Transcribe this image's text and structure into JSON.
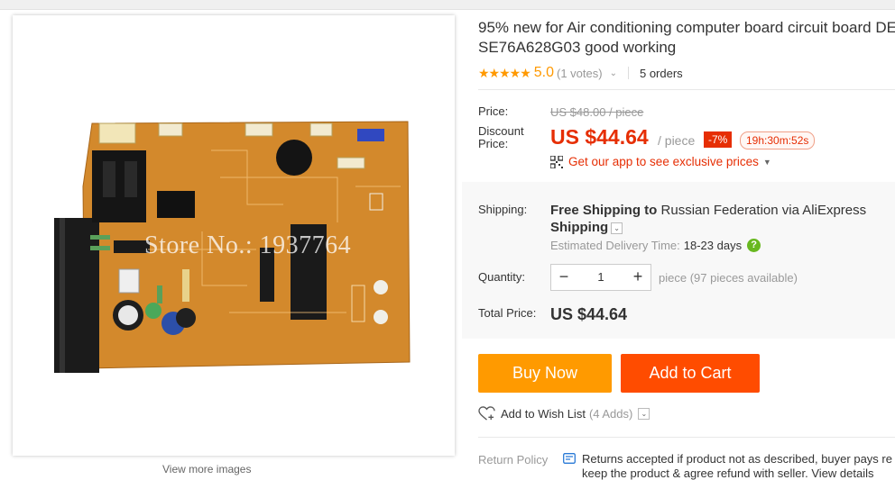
{
  "product": {
    "title_line1": "95% new for Air conditioning computer board circuit board DE",
    "title_line2": "SE76A628G03 good working",
    "image_watermark": "Store No.: 1937764",
    "view_more": "View more images"
  },
  "rating": {
    "stars": "★★★★★",
    "score": "5.0",
    "votes": "(1 votes)",
    "orders": "5 orders"
  },
  "pricing": {
    "price_label": "Price:",
    "original_price": "US $48.00 / piece",
    "discount_label_line1": "Discount",
    "discount_label_line2": "Price:",
    "discount_price": "US $44.64",
    "per_piece": "/ piece",
    "discount_badge": "-7%",
    "timer": "19h:30m:52s",
    "app_promo": "Get our app to see exclusive prices"
  },
  "shipping": {
    "label": "Shipping:",
    "free_text": "Free Shipping to",
    "destination": "Russian Federation via AliExpress",
    "method_suffix": "Shipping",
    "delivery_label": "Estimated Delivery Time:",
    "delivery_days": "18-23 days"
  },
  "quantity": {
    "label": "Quantity:",
    "minus": "−",
    "value": "1",
    "plus": "+",
    "available": "piece (97 pieces available)"
  },
  "total": {
    "label": "Total Price:",
    "value": "US $44.64"
  },
  "actions": {
    "buy_now": "Buy Now",
    "add_to_cart": "Add to Cart",
    "wishlist": "Add to Wish List",
    "wishlist_count": "(4 Adds)"
  },
  "return_policy": {
    "label": "Return Policy",
    "text_line1": "Returns accepted if product not as described, buyer pays re",
    "text_line2": "keep the product & agree refund with seller. View details"
  },
  "colors": {
    "price_red": "#e62e04",
    "buy_orange": "#ff9a00",
    "cart_orange": "#ff4c00",
    "star_orange": "#ff9900"
  }
}
